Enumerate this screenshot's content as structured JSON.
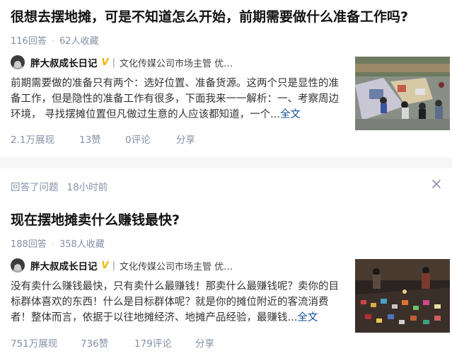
{
  "feed": [
    {
      "title": "很想去摆地摊，可是不知道怎么开始，前期需要做什么准备工作吗?",
      "answers": "116回答",
      "favorites": "62人收藏",
      "author": {
        "name": "胖大叔成长日记",
        "badge": "V",
        "description": "文化传媒公司市场主管 优质职..."
      },
      "excerpt": "前期需要做的准备只有两个：选好位置、准备货源。这两个只是显性的准备工作，但是隐性的准备工作有很多，下面我来一一解析：一、考察周边环境， 寻找摆摊位置但凡做过生意的人应该都知道，一个...",
      "more": "全文",
      "actions": {
        "views": "2.1万展现",
        "likes": "13赞",
        "comments": "0评论",
        "share": "分享"
      },
      "thumb_icon": "street-market-photo"
    },
    {
      "activity": "回答了问题",
      "time": "18小时前",
      "title": "现在摆地摊卖什么赚钱最快?",
      "answers": "188回答",
      "favorites": "358人收藏",
      "author": {
        "name": "胖大叔成长日记",
        "badge": "V",
        "description": "文化传媒公司市场主管 优质职..."
      },
      "excerpt": "没有卖什么赚钱最快，只有卖什么最赚钱！那卖什么最赚钱呢？卖你的目标群体喜欢的东西！什么是目标群体呢？就是你的摊位附近的客流消费者！整体而言，依据于以往地摊经济、地摊产品经验，最赚钱...",
      "more": "全文",
      "actions": {
        "views": "751万展现",
        "likes": "736赞",
        "comments": "179评论",
        "share": "分享"
      },
      "thumb_icon": "night-market-photo"
    }
  ]
}
